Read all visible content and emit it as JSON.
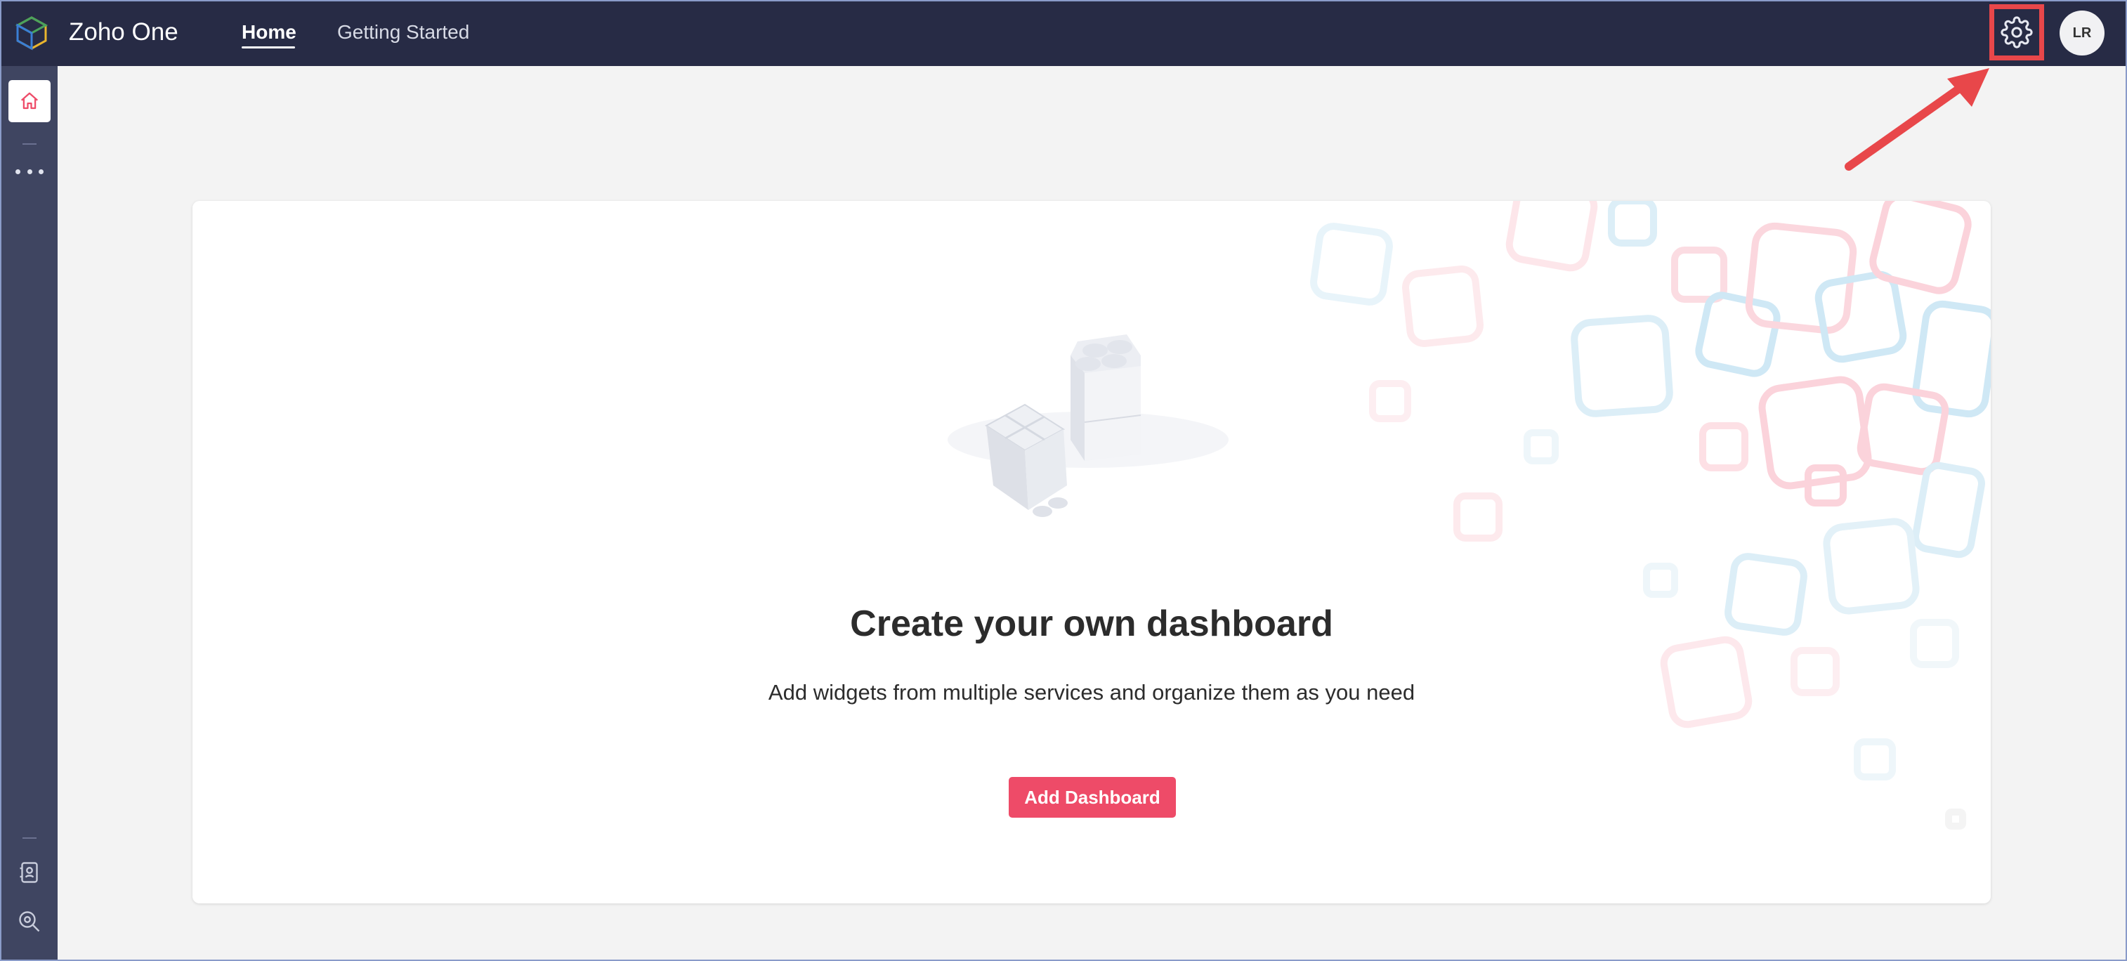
{
  "header": {
    "app_title": "Zoho One",
    "tabs": [
      {
        "label": "Home",
        "active": true
      },
      {
        "label": "Getting Started",
        "active": false
      }
    ],
    "settings_icon": "gear-icon",
    "avatar_initials": "LR"
  },
  "sidebar": {
    "items": [
      {
        "icon": "home-icon",
        "active": true
      },
      {
        "icon": "more-icon"
      },
      {
        "icon": "contacts-icon"
      },
      {
        "icon": "search-settings-icon"
      }
    ]
  },
  "main": {
    "headline": "Create your own dashboard",
    "subtitle": "Add widgets from multiple services and organize them as you need",
    "add_button_label": "Add Dashboard"
  },
  "colors": {
    "topbar": "#272b45",
    "siderail": "#3f4561",
    "accent": "#ee4b68",
    "annotation": "#e8474a"
  }
}
